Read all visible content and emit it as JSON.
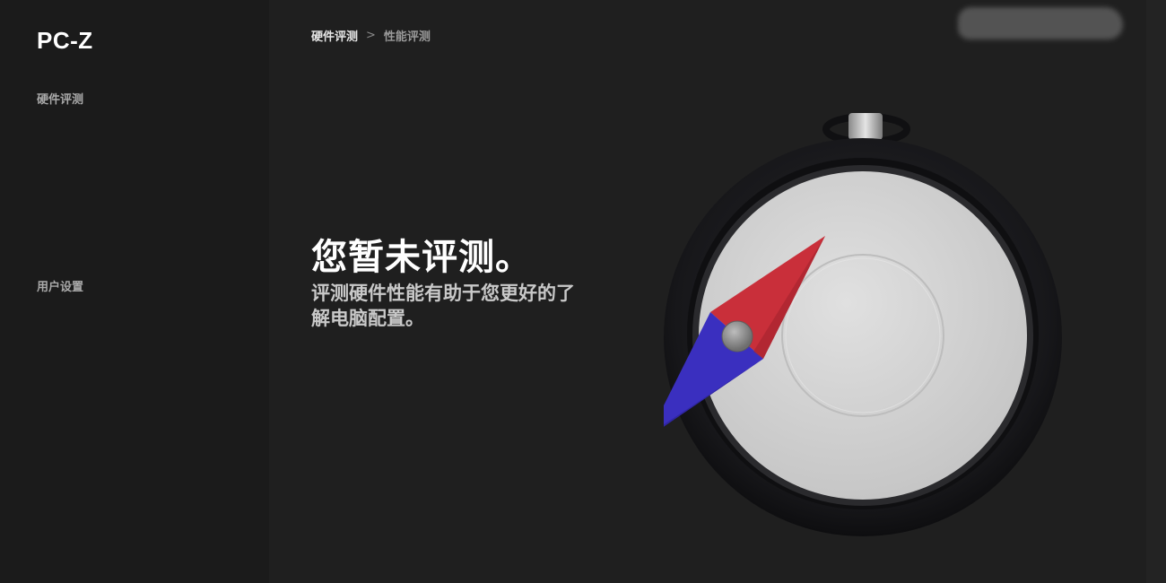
{
  "app": {
    "title": "PC-Z"
  },
  "sidebar": {
    "items": [
      {
        "label": "硬件评测"
      },
      {
        "label": "用户设置"
      }
    ]
  },
  "breadcrumb": {
    "root": "硬件评测",
    "separator": ">",
    "current": "性能评测"
  },
  "empty_state": {
    "headline": "您暂未评测。",
    "subtext": "评测硬件性能有助于您更好的了解电脑配置。",
    "illustration": "compass-icon"
  },
  "colors": {
    "background": "#1f1f1f",
    "sidebar": "#1b1b1b",
    "needle_north": "#c92f3a",
    "needle_south": "#3a2fbf",
    "dial": "#d3d3d3",
    "bezel": "#1a1a1d"
  }
}
